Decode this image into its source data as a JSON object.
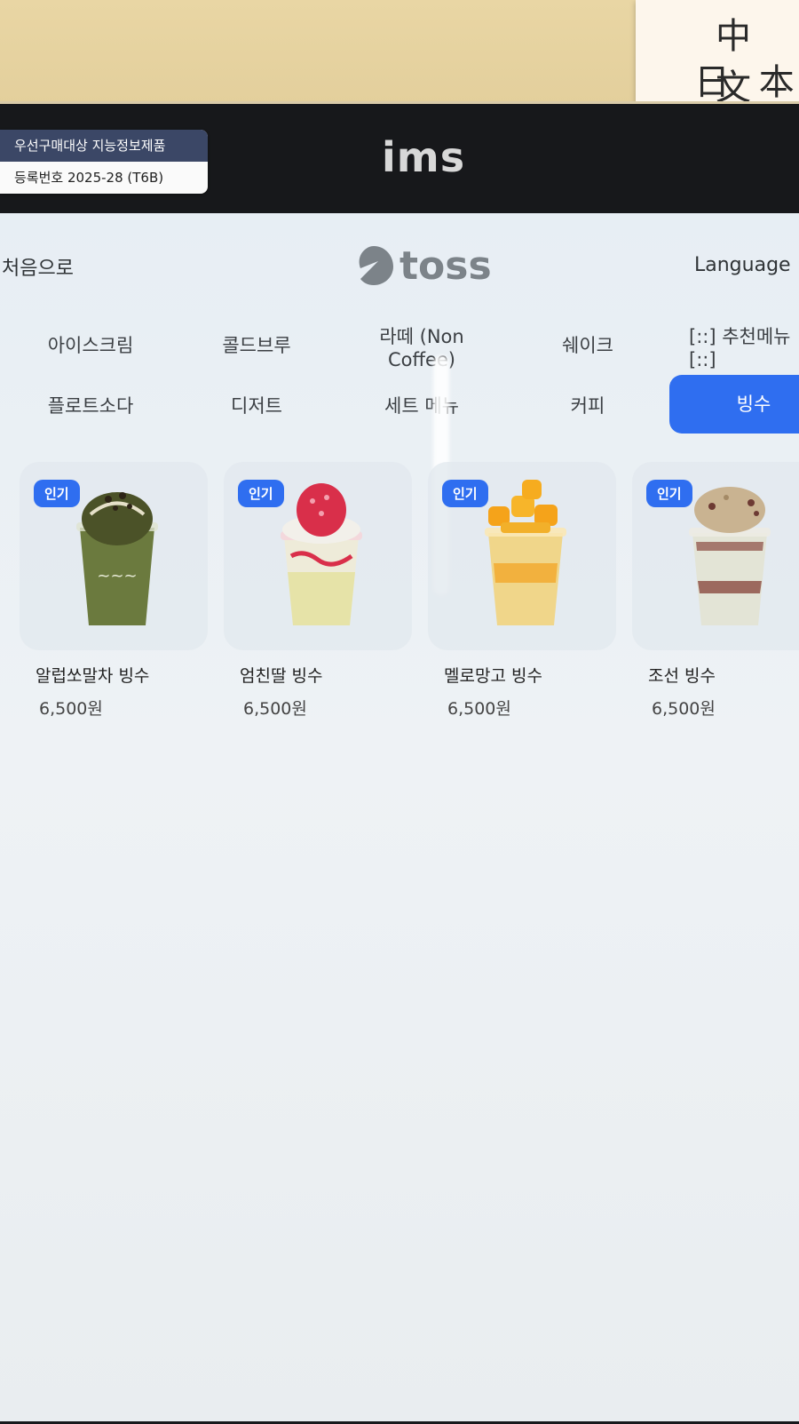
{
  "environment": {
    "brand": "ims",
    "certificate": {
      "line1": "우선구매대상 지능정보제품",
      "line2": "등록번호 2025-28 (T6B)"
    },
    "sticky_note": {
      "line1": "中 文",
      "line2": "日 本"
    }
  },
  "kiosk": {
    "home_label": "처음으로",
    "logo_text": "toss",
    "language_label": "Language",
    "categories_row1": [
      "아이스크림",
      "콜드브루",
      "라떼 (Non Coffee)",
      "쉐이크",
      "[::] 추천메뉴 [::]"
    ],
    "categories_row2": [
      "플로트소다",
      "디저트",
      "세트 메뉴",
      "커피",
      "빙수"
    ],
    "active_category": "빙수",
    "products": [
      {
        "badge": "인기",
        "name": "알럽쏘말차 빙수",
        "price": "6,500원"
      },
      {
        "badge": "인기",
        "name": "엄친딸 빙수",
        "price": "6,500원"
      },
      {
        "badge": "인기",
        "name": "멜로망고 빙수",
        "price": "6,500원"
      },
      {
        "badge": "인기",
        "name": "조선 빙수",
        "price": "6,500원"
      }
    ]
  },
  "colors": {
    "accent": "#2f6ef0",
    "badge_dark": "#3b4766"
  }
}
